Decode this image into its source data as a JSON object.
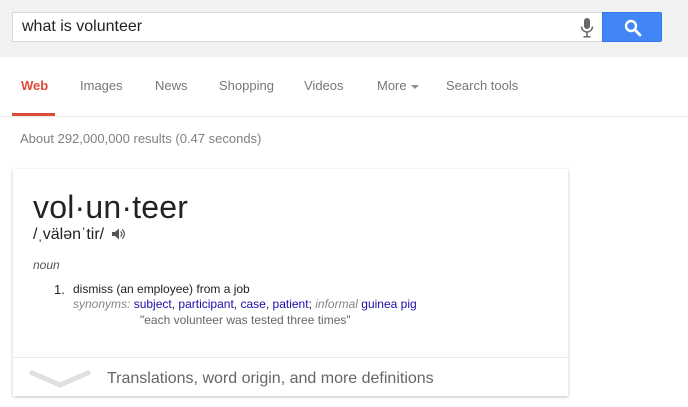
{
  "search": {
    "query": "what is volunteer",
    "voice_icon": "microphone-icon",
    "button_icon": "magnifier-icon",
    "button_color": "#4285f4"
  },
  "tabs": [
    {
      "label": "Web",
      "active": true
    },
    {
      "label": "Images"
    },
    {
      "label": "News"
    },
    {
      "label": "Shopping"
    },
    {
      "label": "Videos"
    },
    {
      "label": "More"
    },
    {
      "label": "Search tools"
    }
  ],
  "results_stats": "About 292,000,000 results (0.47 seconds)",
  "definition": {
    "word": "vol·un·teer",
    "pronunciation": "/ˌvälənˈtir/",
    "speaker_icon": "speaker-icon",
    "part_of_speech": "noun",
    "senses": [
      {
        "number": "1.",
        "text": "dismiss (an employee) from a job",
        "synonyms_label": "synonyms:",
        "synonyms": [
          "subject",
          "participant",
          "case",
          "patient"
        ],
        "informal_label": "informal",
        "informal_synonym": "guinea pig",
        "example": "\"each volunteer was tested three times\""
      }
    ],
    "more_text": "Translations, word origin, and more definitions",
    "expand_icon": "chevron-down-icon"
  },
  "colors": {
    "active_tab": "#dd4b39",
    "link": "#1a0dab"
  }
}
